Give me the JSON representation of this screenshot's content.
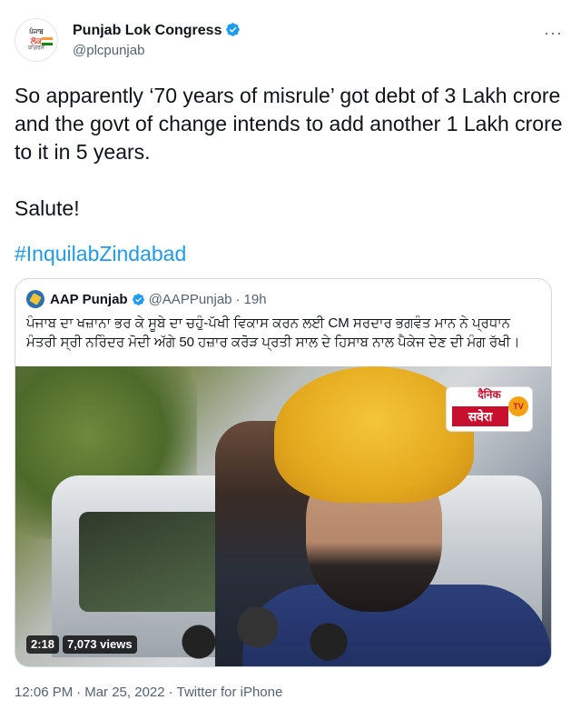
{
  "author": {
    "name": "Punjab Lok Congress",
    "handle": "@plcpunjab",
    "avatar_lines": [
      "ਪੰਜਾਬ",
      "ਲੋਕ",
      "ਕਾਂਗਰਸ"
    ]
  },
  "more_label": "···",
  "tweet": {
    "text": "So apparently ‘70 years of misrule’ got debt of 3 Lakh crore and the govt of change intends to add another 1 Lakh crore to it in 5 years.\n\nSalute!",
    "hashtag": "#InquilabZindabad"
  },
  "quoted": {
    "name": "AAP Punjab",
    "handle": "@AAPPunjab",
    "time": "19h",
    "text": "ਪੰਜਾਬ ਦਾ ਖਜ਼ਾਨਾ ਭਰ ਕੇ ਸੂਬੇ ਦਾ ਚਹੁੰ-ਪੱਖੀ ਵਿਕਾਸ ਕਰਨ ਲਈ CM ਸਰਦਾਰ ਭਗਵੰਤ ਮਾਨ ਨੇ ਪ੍ਰਧਾਨ ਮੰਤਰੀ ਸ੍ਰੀ ਨਰਿੰਦਰ ਮੋਦੀ ਅੱਗੇ 50 ਹਜ਼ਾਰ ਕਰੋੜ ਪ੍ਰਤੀ ਸਾਲ ਦੇ ਹਿਸਾਬ ਨਾਲ ਪੈਕੇਜ ਦੇਣ ਦੀ ਮੰਗ ਰੱਖੀ।",
    "video": {
      "duration": "2:18",
      "views": "7,073 views",
      "logo_top": "दैनिक",
      "logo_bottom": "सवेरा",
      "logo_tv": "TV"
    }
  },
  "footer": {
    "time": "12:06 PM",
    "date": "Mar 25, 2022",
    "source": "Twitter for iPhone",
    "separator": "·"
  },
  "colors": {
    "link": "#1d9bf0",
    "verified": "#1d9bf0",
    "secondary": "#536471"
  }
}
